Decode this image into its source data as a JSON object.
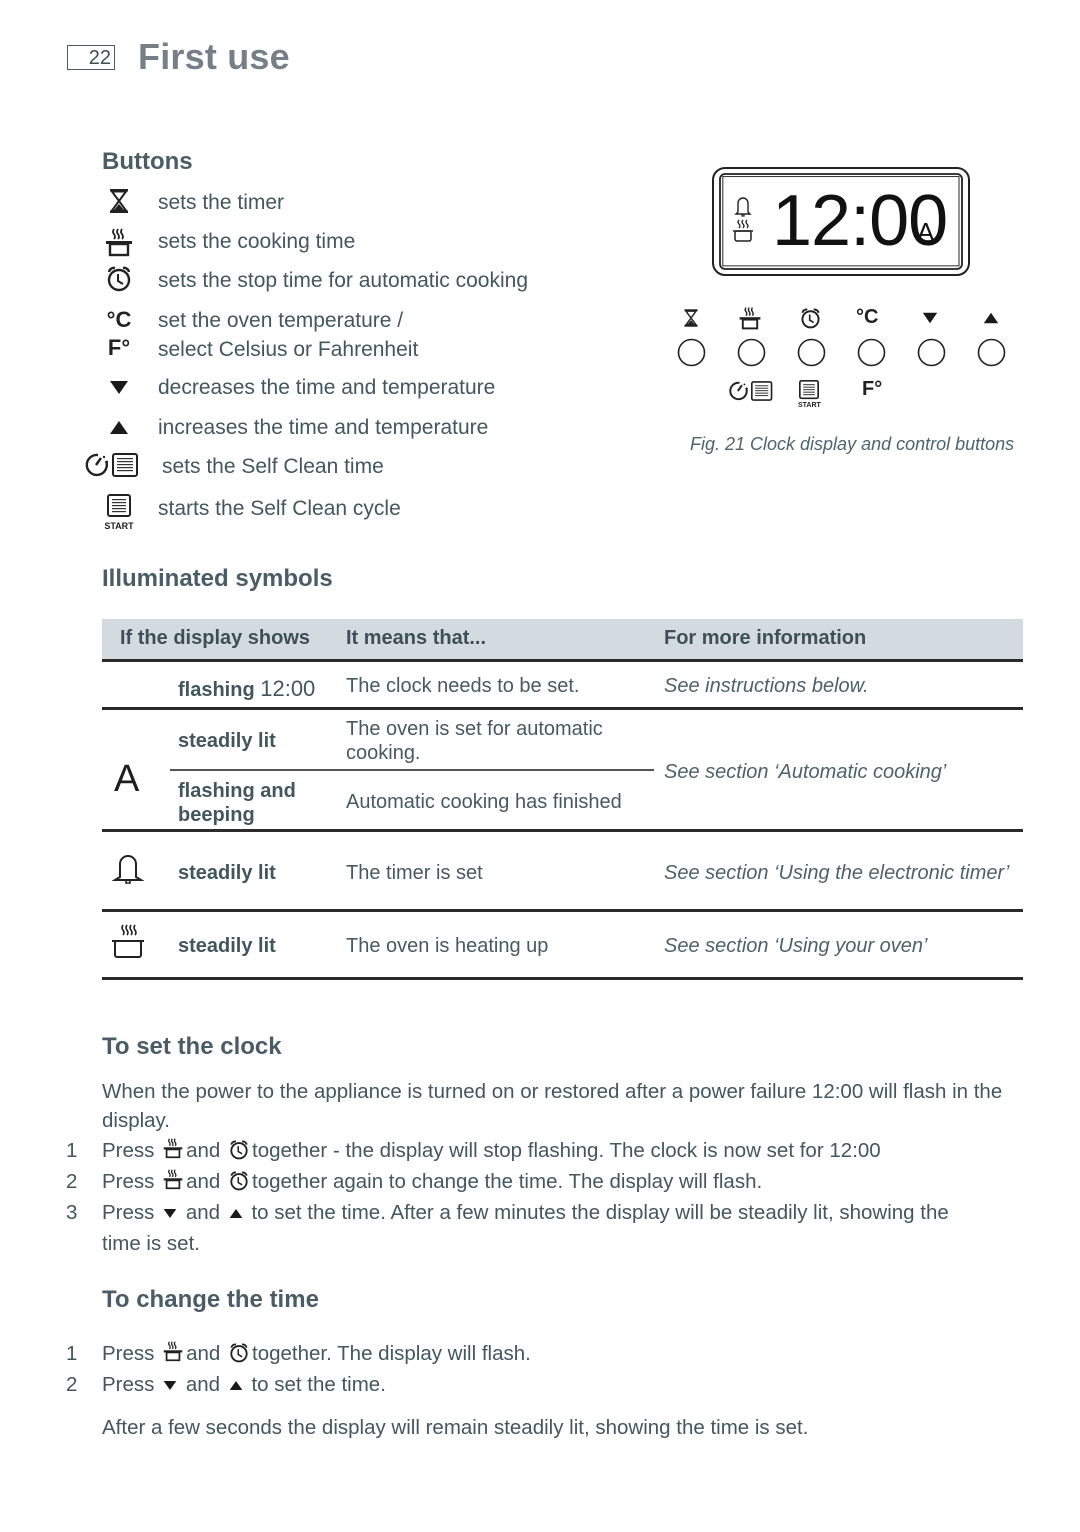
{
  "page": {
    "number": "22",
    "title": "First use"
  },
  "buttons_section": {
    "heading": "Buttons",
    "items": [
      {
        "icon": "hourglass-icon",
        "text": "sets the timer"
      },
      {
        "icon": "cooking-pot-icon",
        "text": "sets the cooking time"
      },
      {
        "icon": "alarm-clock-icon",
        "text": "sets the stop time for automatic cooking"
      },
      {
        "icon": "celsius-fahrenheit-icon",
        "text": "set the oven temperature /",
        "text2": "select Celsius or Fahrenheit",
        "glyph_c": "°C",
        "glyph_f": "F°"
      },
      {
        "icon": "down-arrow-icon",
        "text": "decreases the time and temperature"
      },
      {
        "icon": "up-arrow-icon",
        "text": "increases the time and temperature"
      },
      {
        "icon": "self-clean-timer-icon",
        "text": "sets the Self Clean time"
      },
      {
        "icon": "self-clean-start-icon",
        "text": "starts the Self Clean cycle",
        "sublabel": "START"
      }
    ]
  },
  "figure": {
    "display_time": "12:00",
    "display_indicator": "A",
    "control_labels": [
      "hourglass",
      "cooking-pot",
      "alarm-clock",
      "°C",
      "▼",
      "▲"
    ],
    "second_row": {
      "celsius_alt": "F°",
      "start_label": "START"
    },
    "caption": "Fig. 21 Clock display and control buttons"
  },
  "illuminated_section": {
    "heading": "Illuminated symbols",
    "table": {
      "headers": [
        "If the display shows",
        "It means that...",
        "For more information"
      ],
      "rows": [
        {
          "symbol": "",
          "state": "flashing",
          "state_suffix": "12:00",
          "meaning": "The clock needs to be set.",
          "info": "See instructions below."
        },
        {
          "symbol": "A",
          "state": "steadily lit",
          "meaning": "The oven is set for automatic cooking.",
          "info": "See section ‘Automatic cooking’"
        },
        {
          "symbol": "A",
          "state": "flashing and beeping",
          "meaning": "Automatic cooking has finished",
          "info": "See section ‘Automatic cooking’"
        },
        {
          "symbol": "bell-icon",
          "state": "steadily lit",
          "meaning": "The timer is set",
          "info": "See section ‘Using the electronic timer’"
        },
        {
          "symbol": "cooking-pot-icon",
          "state": "steadily lit",
          "meaning": "The oven is heating up",
          "info": "See section ‘Using your oven’"
        }
      ]
    }
  },
  "set_clock": {
    "heading": "To set the clock",
    "intro": "When the power to the appliance is turned on or restored after a power failure 12:00 will flash in the display.",
    "steps": [
      {
        "num": "1",
        "pre": "Press",
        "mid": "and",
        "post": "together - the display will stop flashing. The clock is now set for 12:00"
      },
      {
        "num": "2",
        "pre": "Press",
        "mid": "and",
        "post": "together again to change the time. The display will flash."
      },
      {
        "num": "3",
        "pre": "Press",
        "mid": "and",
        "post": "to set the time. After a few minutes the display will be steadily lit, showing the",
        "post2": "time is set."
      }
    ]
  },
  "change_time": {
    "heading": "To change the time",
    "steps": [
      {
        "num": "1",
        "pre": "Press",
        "mid": "and",
        "post": "together. The display will flash."
      },
      {
        "num": "2",
        "pre": "Press",
        "mid": "and",
        "post": "to set the time."
      }
    ],
    "outro": "After a few seconds the display will remain steadily lit, showing the time is set."
  },
  "colors": {
    "title_gray": "#747f88",
    "heading": "#4a5d67",
    "body_text": "#425760",
    "table_header_bg": "#d4dbe0",
    "rule": "#2b2b2b"
  }
}
